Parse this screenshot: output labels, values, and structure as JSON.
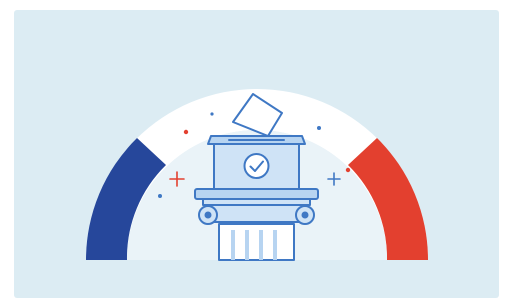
{
  "illustration": {
    "icon": "ballot-box-on-column-icon",
    "colors": {
      "background": "#dcecf3",
      "flag_blue": "#26479b",
      "flag_white": "#ffffff",
      "flag_red": "#e3402f",
      "inner_disc": "#eaf3f8",
      "outline": "#3f78c4",
      "fill_light": "#cfe3f6",
      "fill_mid": "#b7d4f1",
      "paper": "#ffffff",
      "spark_red": "#e3402f",
      "spark_blue": "#3f78c4"
    }
  }
}
